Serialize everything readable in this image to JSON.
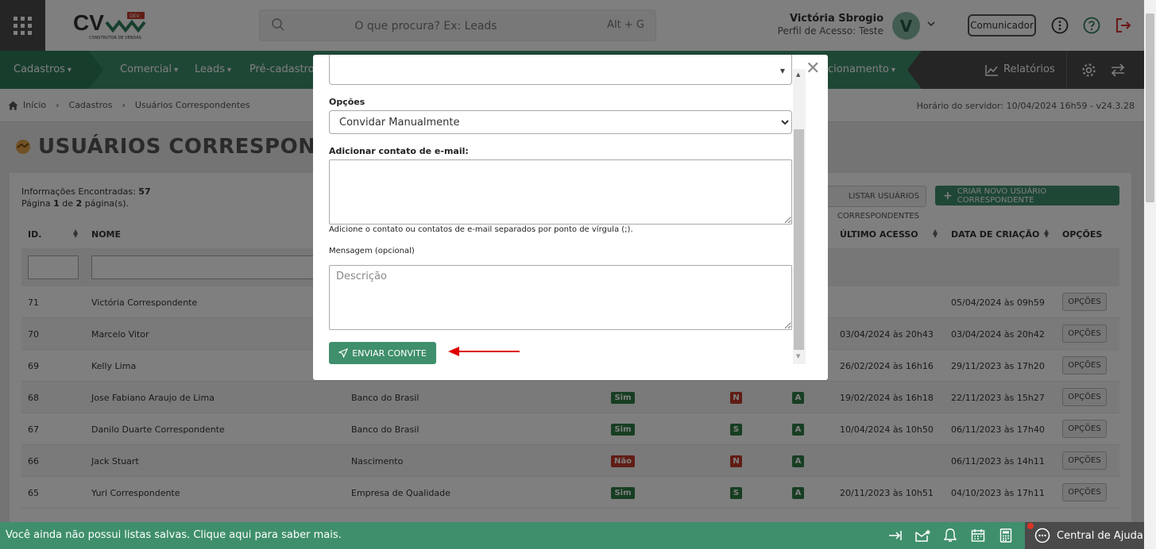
{
  "header": {
    "search_placeholder": "O que procura? Ex: Leads",
    "search_shortcut": "Alt + G",
    "user_name": "Victória Sbrogio",
    "user_profile": "Perfil de Acesso: Teste",
    "avatar_initial": "V",
    "comunicador_label": "Comunicador",
    "logo_text": "CV",
    "logo_tag": "DEV",
    "logo_sub": "CONSTRUTOR DE VENDAS"
  },
  "nav": {
    "items": [
      "Cadastros",
      "Comercial",
      "Leads",
      "Pré-cadastros",
      "cionamento"
    ],
    "relatorios": "Relatórios"
  },
  "breadcrumb": {
    "items": [
      "Início",
      "Cadastros",
      "Usuários Correspondentes"
    ],
    "server_time": "Horário do servidor: 10/04/2024 16h59 - v24.3.28"
  },
  "page": {
    "title": "USUÁRIOS CORRESPONDENTES",
    "info_label": "Informações Encontradas:",
    "info_count": "57",
    "page_label": "Página",
    "page_current": "1",
    "page_of": "de",
    "page_total": "2",
    "page_suffix": "página(s).",
    "list_button": "LISTAR USUÁRIOS CORRESPONDENTES",
    "new_button": "CRIAR NOVO USUÁRIO CORRESPONDENTE"
  },
  "table": {
    "headers": {
      "id": "ID.",
      "name": "NOME",
      "last_access": "ÚLTIMO ACESSO",
      "created": "DATA DE CRIAÇÃO",
      "options": "OPÇÕES"
    },
    "option_label": "OPÇÕES",
    "rows": [
      {
        "id": "71",
        "name": "Victória Correspondente",
        "company": "",
        "active": "",
        "s": "",
        "a": "",
        "last": "",
        "created": "05/04/2024 às 09h59"
      },
      {
        "id": "70",
        "name": "Marcelo Vitor",
        "company": "",
        "active": "",
        "s": "",
        "a": "",
        "last": "03/04/2024 às 20h43",
        "created": "03/04/2024 às 20h42"
      },
      {
        "id": "69",
        "name": "Kelly Lima",
        "company": "",
        "active": "",
        "s": "",
        "a": "",
        "last": "26/02/2024 às 16h16",
        "created": "29/11/2023 às 17h20"
      },
      {
        "id": "68",
        "name": "Jose Fabiano Araujo de Lima",
        "company": "Banco do Brasil",
        "active": "Sim",
        "s": "N",
        "a": "A",
        "last": "19/02/2024 às 16h18",
        "created": "22/11/2023 às 15h27"
      },
      {
        "id": "67",
        "name": "Danilo Duarte Correspondente",
        "company": "Banco do Brasil",
        "active": "Sim",
        "s": "S",
        "a": "A",
        "last": "10/04/2024 às 10h50",
        "created": "06/11/2023 às 17h40"
      },
      {
        "id": "66",
        "name": "Jack Stuart",
        "company": "Nascimento",
        "active": "Não",
        "s": "N",
        "a": "A",
        "last": "",
        "created": "06/11/2023 às 14h11"
      },
      {
        "id": "65",
        "name": "Yuri Correspondente",
        "company": "Empresa de Qualidade",
        "active": "Sim",
        "s": "S",
        "a": "A",
        "last": "20/11/2023 às 10h51",
        "created": "04/10/2023 às 17h11"
      }
    ]
  },
  "modal": {
    "options_label": "Opções",
    "options_selected": "Convidar Manualmente",
    "email_label": "Adicionar contato de e-mail:",
    "email_hint": "Adicione o contato ou contatos de e-mail separados por ponto de vírgula (;).",
    "message_label": "Mensagem (opcional)",
    "message_placeholder": "Descrição",
    "send_button": "ENVIAR CONVITE"
  },
  "bottom": {
    "message": "Você ainda não possui listas salvas. Clique aqui para saber mais.",
    "help": "Central de Ajuda"
  },
  "colors": {
    "primary": "#3f8f6c",
    "dark": "#4a4a4a",
    "badge_green": "#2f7d44",
    "badge_red": "#c03a2b",
    "annotation_arrow": "#e00000"
  }
}
